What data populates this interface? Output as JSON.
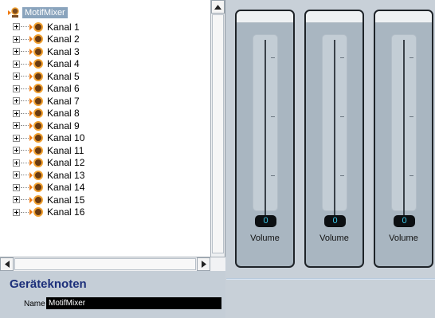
{
  "tree": {
    "root_label": "MotifMixer",
    "nodes": [
      {
        "label": "Kanal 1"
      },
      {
        "label": "Kanal 2"
      },
      {
        "label": "Kanal 3"
      },
      {
        "label": "Kanal 4"
      },
      {
        "label": "Kanal 5"
      },
      {
        "label": "Kanal 6"
      },
      {
        "label": "Kanal 7"
      },
      {
        "label": "Kanal 8"
      },
      {
        "label": "Kanal 9"
      },
      {
        "label": "Kanal 10"
      },
      {
        "label": "Kanal 11"
      },
      {
        "label": "Kanal 12"
      },
      {
        "label": "Kanal 13"
      },
      {
        "label": "Kanal 14"
      },
      {
        "label": "Kanal 15"
      },
      {
        "label": "Kanal 16"
      }
    ]
  },
  "properties": {
    "title": "Geräteknoten",
    "name_label": "Name",
    "name_value": "MotifMixer"
  },
  "mixer": {
    "strips": [
      {
        "value": "0",
        "label": "Volume"
      },
      {
        "value": "0",
        "label": "Volume"
      },
      {
        "value": "0",
        "label": "Volume"
      }
    ]
  },
  "colors": {
    "accent": "#1c2f7a",
    "root_highlight": "#8aa4bd",
    "value_text": "#3cc8e8",
    "strip_background": "#a9b6c1"
  },
  "icons": {
    "expander": "plus-box-icon",
    "node": "channel-node-icon",
    "root": "device-root-icon"
  }
}
